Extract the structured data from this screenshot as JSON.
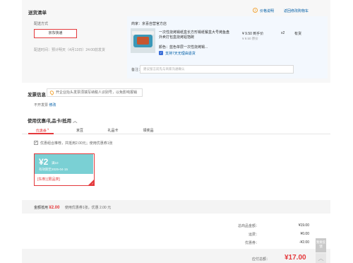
{
  "goods_list": {
    "title": "送货清单",
    "price_diff_link": "价格说明",
    "back_cart_link": "返回修改购物车",
    "shipping": {
      "label": "配送方式",
      "method": "京东快递",
      "time": "配送时间：预计明天（4月13日）24:00前发货"
    },
    "store": {
      "name": "商家：京喜自营官方店",
      "goods_name": "一次性烧烤锡纸盒长方形锡纸餐盒大号烤鱼盘外卖打包盒烧烤铝箔碗",
      "spec": "颜色：蓝色单层一次性烧烤锡...",
      "price": "¥ 9.50 到手价",
      "price_original": "¥ 9.50 原价",
      "qty": "x2",
      "stock": "有货",
      "service": "支持7天无理由退货",
      "remark_label": "备注：",
      "remark_placeholder": "建议留言前先与商家沟通确认"
    }
  },
  "invoice": {
    "title": "发票信息",
    "hint": "开企业抬头发票须填写纳税人识别号，以免影响报销",
    "status": "不开发票",
    "edit": "修改"
  },
  "coupons": {
    "title": "使用优惠/礼品卡/抵用",
    "tabs": [
      "优惠券",
      "京豆",
      "礼品卡",
      "领奖品"
    ],
    "tab_badge": "5",
    "checkbox_label": "优惠组合推荐，共抵用2.00元；使用优惠券1张",
    "card": {
      "amount": "¥2",
      "condition": "满10",
      "date": "有效期至2025-04-15",
      "tags": "[东券] [限品类]"
    },
    "summary_label": "金额抵用",
    "summary_amount": "¥2.00",
    "summary_desc": "使用优惠券1张，优惠 2.00 元"
  },
  "totals": {
    "rows": [
      {
        "label": "总商品金额：",
        "value": "¥19.00"
      },
      {
        "label": "运费：",
        "value": "¥0.00"
      },
      {
        "label": "优惠券：",
        "value": "-¥2.00"
      }
    ],
    "pay_label": "应付总额：",
    "pay_amount": "¥17.00"
  },
  "side": {
    "feedback": "我要反馈",
    "up_icon": "chevron-up-icon"
  },
  "colors": {
    "accent": "#e4393c",
    "link": "#005ea7",
    "coupon": "#7ad0d4"
  }
}
